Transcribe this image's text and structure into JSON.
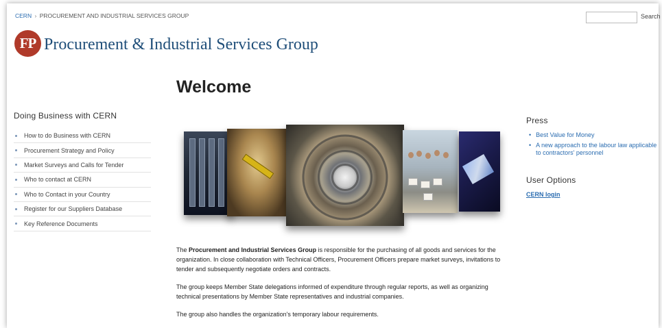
{
  "breadcrumb": {
    "root": "CERN",
    "separator": "›",
    "current": "PROCUREMENT AND INDUSTRIAL SERVICES GROUP"
  },
  "search": {
    "value": "",
    "placeholder": "",
    "button_label": "Search"
  },
  "logo": {
    "mark": "FP",
    "text": "Procurement & Industrial Services Group"
  },
  "main": {
    "title": "Welcome",
    "paragraphs": [
      {
        "before": "The ",
        "bold": "Procurement and Industrial Services Group",
        "after": " is responsible for the purchasing of all goods and services for the organization. In close collaboration with Technical Officers, Procurement Officers prepare market surveys, invitations to tender and subsequently negotiate orders and contracts."
      },
      {
        "text": "The group keeps Member State delegations informed of expenditure through regular reports, as well as organizing technical presentations by Member State representatives and industrial companies."
      },
      {
        "text": "The group also handles the organization's temporary labour requirements."
      }
    ]
  },
  "sidebar": {
    "title": "Doing Business with CERN",
    "items": [
      {
        "label": "How to do Business with CERN"
      },
      {
        "label": "Procurement Strategy and Policy"
      },
      {
        "label": "Market Surveys and Calls for Tender"
      },
      {
        "label": "Who to contact at CERN"
      },
      {
        "label": "Who to Contact in your Country"
      },
      {
        "label": "Register for our Suppliers Database"
      },
      {
        "label": "Key Reference Documents"
      }
    ]
  },
  "press": {
    "title": "Press",
    "items": [
      {
        "label": "Best Value for Money"
      },
      {
        "label": "A new approach to the labour law applicable to contractors' personnel"
      }
    ]
  },
  "user_options": {
    "title": "User Options",
    "login_label": "CERN login"
  },
  "colors": {
    "link": "#2a6cb0",
    "logo_mark": "#b03a2a",
    "logo_text": "#1f4e79"
  }
}
